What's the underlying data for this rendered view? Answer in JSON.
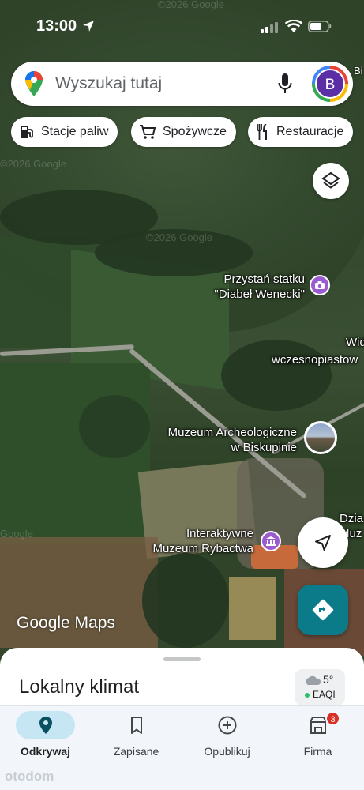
{
  "status_bar": {
    "time": "13:00"
  },
  "search": {
    "placeholder": "Wyszukaj tutaj",
    "avatar_initial": "B",
    "edge_text": "Bi"
  },
  "chips": [
    {
      "label": "Stacje paliw",
      "icon": "gas-station-icon"
    },
    {
      "label": "Spożywcze",
      "icon": "cart-icon"
    },
    {
      "label": "Restauracje",
      "icon": "fork-knife-icon"
    }
  ],
  "map": {
    "watermarks": [
      "©2026 Google",
      "©2026 Google",
      "©2026 Google",
      "Google"
    ],
    "labels": {
      "przystan_line1": "Przystań statku",
      "przystan_line2": "\"Diabeł Wenecki\"",
      "wid": "Wid",
      "wczesno": "wczesnopiastow",
      "muzeum_arch_line1": "Muzeum Archeologiczne",
      "muzeum_arch_line2": "w Biskupinie",
      "dzia_line1": "Dzia",
      "dzia_line2": "Muz",
      "interaktywne_line1": "Interaktywne",
      "interaktywne_line2": "Muzeum Rybactwa"
    },
    "brand": "Google Maps"
  },
  "sheet": {
    "title": "Lokalny klimat",
    "temperature": "5°",
    "aqi_label": "EAQI"
  },
  "nav": {
    "items": [
      {
        "label": "Odkrywaj",
        "icon": "explore-pin-icon",
        "active": true
      },
      {
        "label": "Zapisane",
        "icon": "bookmark-icon",
        "active": false
      },
      {
        "label": "Opublikuj",
        "icon": "add-circle-icon",
        "active": false
      },
      {
        "label": "Firma",
        "icon": "store-icon",
        "active": false,
        "badge": "3"
      }
    ]
  },
  "watermark_overlay": "otodom",
  "colors": {
    "accent_teal": "#0b7b8a",
    "poi_purple": "#9b5bd1",
    "nav_active_pill": "#c5e6f2",
    "badge_red": "#d93025"
  }
}
